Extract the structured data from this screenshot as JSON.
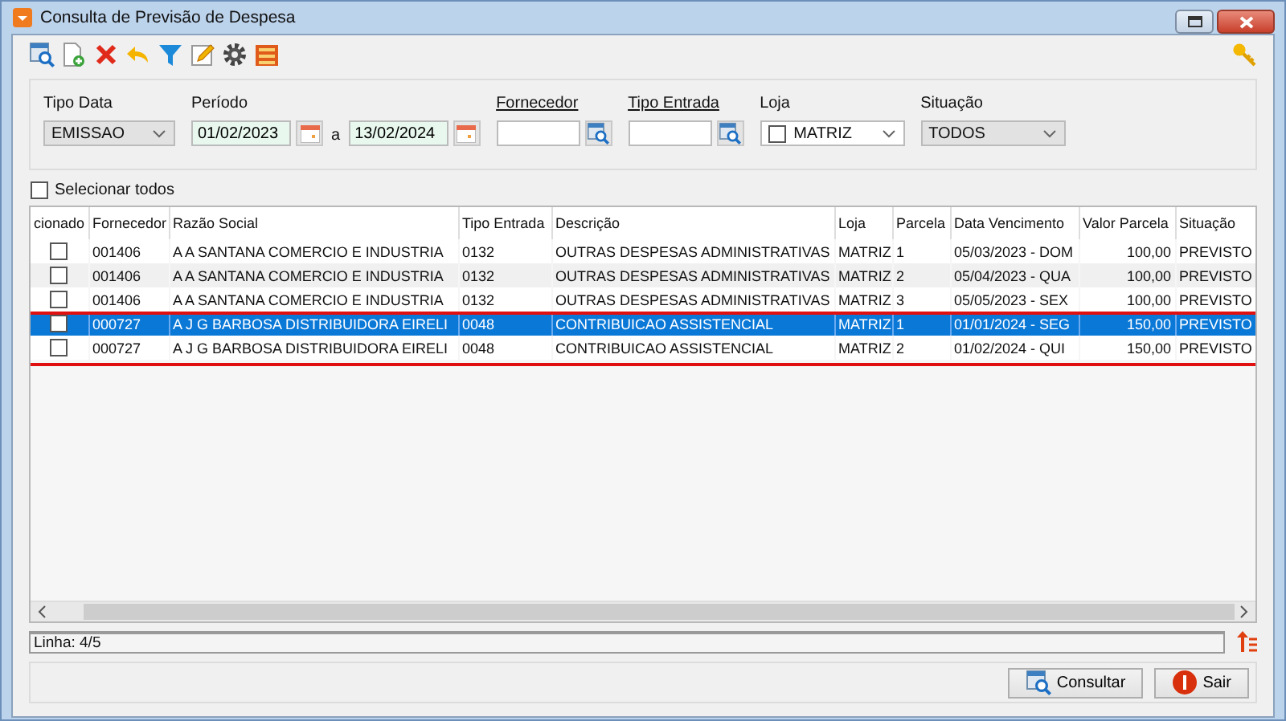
{
  "window": {
    "title": "Consulta de Previsão de Despesa"
  },
  "filters": {
    "tipo_data": {
      "label": "Tipo Data",
      "value": "EMISSAO"
    },
    "periodo": {
      "label": "Período",
      "from": "01/02/2023",
      "separator": "a",
      "to": "13/02/2024"
    },
    "fornecedor": {
      "label": "Fornecedor"
    },
    "tipo_entrada": {
      "label": "Tipo Entrada"
    },
    "loja": {
      "label": "Loja",
      "checked": false,
      "value": "MATRIZ"
    },
    "situacao": {
      "label": "Situação",
      "value": "TODOS"
    }
  },
  "select_all": {
    "label": "Selecionar todos",
    "checked": false
  },
  "table": {
    "checkbox_column": "cionado",
    "columns": [
      "Fornecedor",
      "Razão Social",
      "Tipo Entrada",
      "Descrição",
      "Loja",
      "Parcela",
      "Data Vencimento",
      "Valor Parcela",
      "Situação"
    ],
    "rows": [
      {
        "selected": false,
        "checked": false,
        "annotated": false,
        "cells": [
          "001406",
          "A A SANTANA COMERCIO E INDUSTRIA",
          "0132",
          "OUTRAS DESPESAS ADMINISTRATIVAS",
          "MATRIZ",
          "1",
          "05/03/2023 - DOM",
          "100,00",
          "PREVISTO"
        ]
      },
      {
        "selected": false,
        "checked": false,
        "annotated": false,
        "cells": [
          "001406",
          "A A SANTANA COMERCIO E INDUSTRIA",
          "0132",
          "OUTRAS DESPESAS ADMINISTRATIVAS",
          "MATRIZ",
          "2",
          "05/04/2023 - QUA",
          "100,00",
          "PREVISTO"
        ]
      },
      {
        "selected": false,
        "checked": false,
        "annotated": false,
        "cells": [
          "001406",
          "A A SANTANA COMERCIO E INDUSTRIA",
          "0132",
          "OUTRAS DESPESAS ADMINISTRATIVAS",
          "MATRIZ",
          "3",
          "05/05/2023 - SEX",
          "100,00",
          "PREVISTO"
        ]
      },
      {
        "selected": true,
        "checked": false,
        "annotated": true,
        "cells": [
          "000727",
          "A J G BARBOSA DISTRIBUIDORA EIRELI",
          "0048",
          "CONTRIBUICAO ASSISTENCIAL",
          "MATRIZ",
          "1",
          "01/01/2024 - SEG",
          "150,00",
          "PREVISTO"
        ]
      },
      {
        "selected": false,
        "checked": false,
        "annotated": true,
        "cells": [
          "000727",
          "A J G BARBOSA DISTRIBUIDORA EIRELI",
          "0048",
          "CONTRIBUICAO ASSISTENCIAL",
          "MATRIZ",
          "2",
          "01/02/2024 - QUI",
          "150,00",
          "PREVISTO"
        ]
      }
    ]
  },
  "status_bar": {
    "text": "Linha: 4/5"
  },
  "buttons": [
    {
      "kind": "search",
      "label": "Consultar"
    },
    {
      "kind": "exit",
      "label": "Sair"
    }
  ]
}
